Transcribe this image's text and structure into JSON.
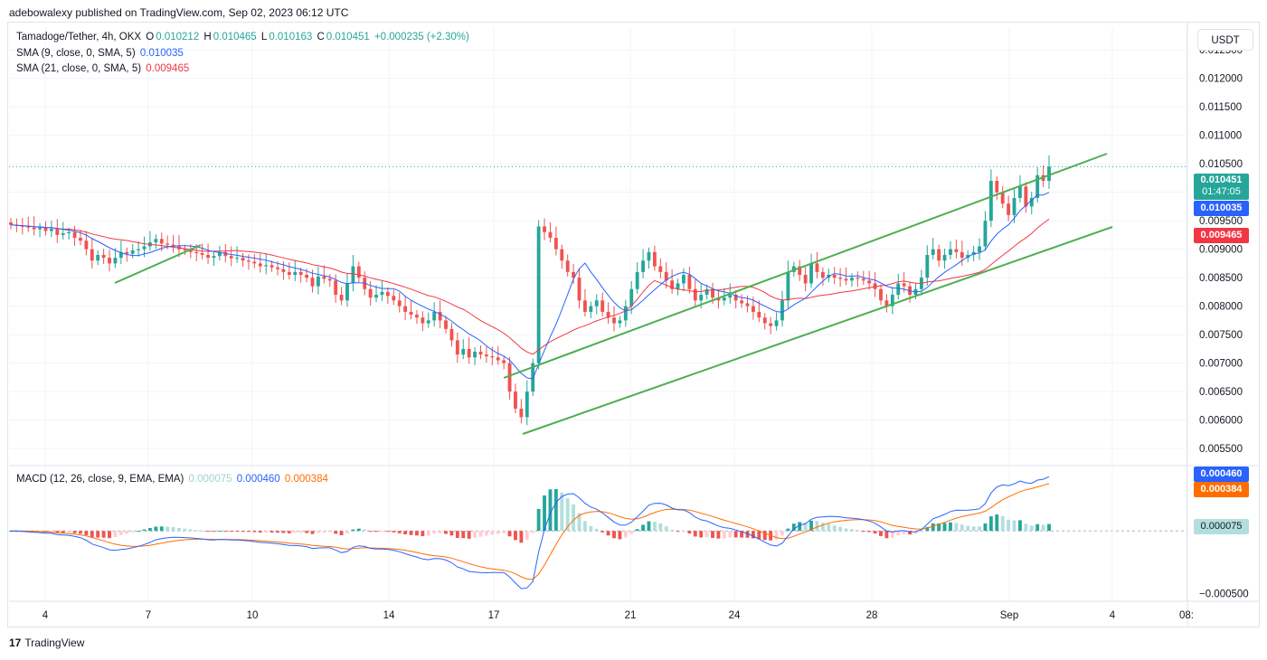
{
  "header": {
    "published_line": "adebowalexy published on TradingView.com, Sep 02, 2023 06:12 UTC",
    "symbol": "Tamadoge/Tether, 4h, OKX",
    "o_label": "O",
    "o_value": "0.010212",
    "h_label": "H",
    "h_value": "0.010465",
    "l_label": "L",
    "l_value": "0.010163",
    "c_label": "C",
    "c_value": "0.010451",
    "change": "+0.000235 (+2.30%)",
    "sma9_label": "SMA (9, close, 0, SMA, 5)",
    "sma9_value": "0.010035",
    "sma21_label": "SMA (21, close, 0, SMA, 5)",
    "sma21_value": "0.009465",
    "macd_label": "MACD (12, 26, close, 9, EMA, EMA)",
    "macd_hist_value": "0.000075",
    "macd_value": "0.000460",
    "macd_signal_value": "0.000384"
  },
  "currency_button": "USDT",
  "tags": {
    "price": "0.010451",
    "countdown": "01:47:05",
    "sma9": "0.010035",
    "sma21": "0.009465",
    "macd": "0.000460",
    "signal": "0.000384",
    "hist": "0.000075"
  },
  "footer": {
    "brand": "TradingView",
    "logo_glyph": "17"
  },
  "colors": {
    "up": "#26a69a",
    "down": "#ef5350",
    "sma9": "#2962ff",
    "sma21": "#f23645",
    "trend": "#4caf50",
    "macd": "#2962ff",
    "signal": "#ff6d00",
    "hist_up_strong": "#26a69a",
    "hist_up_weak": "#b2dfdb",
    "hist_down_strong": "#ef5350",
    "hist_down_weak": "#ffcdd2"
  },
  "chart_data": [
    {
      "type": "candlestick",
      "title": "Tamadoge/Tether, 4h, OKX",
      "y_ticks": [
        "0.012500",
        "0.012000",
        "0.011500",
        "0.011000",
        "0.010500",
        "0.010000",
        "0.009500",
        "0.009000",
        "0.008500",
        "0.008000",
        "0.007500",
        "0.007000",
        "0.006500",
        "0.006000",
        "0.005500"
      ],
      "ylim": [
        0.0052,
        0.0129
      ],
      "x_ticks": [
        "4",
        "7",
        "10",
        "14",
        "17",
        "21",
        "24",
        "28",
        "Sep",
        "4",
        "08:"
      ],
      "price_line": 0.010451,
      "candles_close": [
        0.00943,
        0.00941,
        0.0094,
        0.00938,
        0.00935,
        0.00938,
        0.00932,
        0.00936,
        0.00925,
        0.00928,
        0.0093,
        0.0092,
        0.00915,
        0.009,
        0.0088,
        0.0089,
        0.00885,
        0.00875,
        0.00885,
        0.00895,
        0.00892,
        0.00898,
        0.009,
        0.00905,
        0.00912,
        0.00918,
        0.0091,
        0.00908,
        0.00905,
        0.009,
        0.00898,
        0.00895,
        0.00893,
        0.0089,
        0.00885,
        0.00888,
        0.00895,
        0.00888,
        0.00884,
        0.00885,
        0.0088,
        0.00878,
        0.00875,
        0.0087,
        0.00872,
        0.00868,
        0.00865,
        0.0086,
        0.00855,
        0.0086,
        0.00855,
        0.0085,
        0.00835,
        0.00852,
        0.00848,
        0.00845,
        0.0082,
        0.0081,
        0.0084,
        0.0087,
        0.0085,
        0.0083,
        0.00815,
        0.0082,
        0.00825,
        0.00818,
        0.0081,
        0.008,
        0.0079,
        0.00785,
        0.0078,
        0.0077,
        0.00775,
        0.0079,
        0.00775,
        0.0076,
        0.0074,
        0.00715,
        0.00725,
        0.0071,
        0.0072,
        0.00715,
        0.00712,
        0.0071,
        0.00705,
        0.007,
        0.0065,
        0.0062,
        0.00605,
        0.0065,
        0.007,
        0.0094,
        0.0093,
        0.0092,
        0.009,
        0.0088,
        0.0086,
        0.0085,
        0.0081,
        0.0079,
        0.008,
        0.0081,
        0.0079,
        0.0078,
        0.0077,
        0.00775,
        0.008,
        0.0083,
        0.0086,
        0.0088,
        0.00895,
        0.0087,
        0.0086,
        0.00845,
        0.0083,
        0.0084,
        0.00855,
        0.0083,
        0.0081,
        0.0082,
        0.0083,
        0.00815,
        0.0081,
        0.00815,
        0.0082,
        0.0081,
        0.00805,
        0.008,
        0.0079,
        0.0078,
        0.0077,
        0.00765,
        0.00775,
        0.0081,
        0.0086,
        0.0087,
        0.00855,
        0.0084,
        0.00875,
        0.0086,
        0.0085,
        0.00855,
        0.0085,
        0.00848,
        0.00845,
        0.0085,
        0.00848,
        0.00845,
        0.0084,
        0.0083,
        0.0081,
        0.008,
        0.0082,
        0.0084,
        0.00835,
        0.0082,
        0.0083,
        0.0085,
        0.0089,
        0.009,
        0.0088,
        0.0089,
        0.009,
        0.00895,
        0.00885,
        0.0089,
        0.00895,
        0.00905,
        0.0095,
        0.0102,
        0.01,
        0.0098,
        0.0096,
        0.0099,
        0.0101,
        0.00975,
        0.0099,
        0.0103,
        0.0102,
        0.01045
      ],
      "sma9_label": "SMA (9, close, 0, SMA, 5)",
      "sma21_label": "SMA (21, close, 0, SMA, 5)"
    },
    {
      "type": "bar",
      "title": "MACD (12, 26, close, 9, EMA, EMA)",
      "y_ticks": [
        "0.000000",
        "−0.000500"
      ],
      "ylim": [
        -0.00056,
        0.00052
      ],
      "macd_last": 0.00046,
      "signal_last": 0.000384,
      "hist_last": 7.5e-05
    }
  ]
}
